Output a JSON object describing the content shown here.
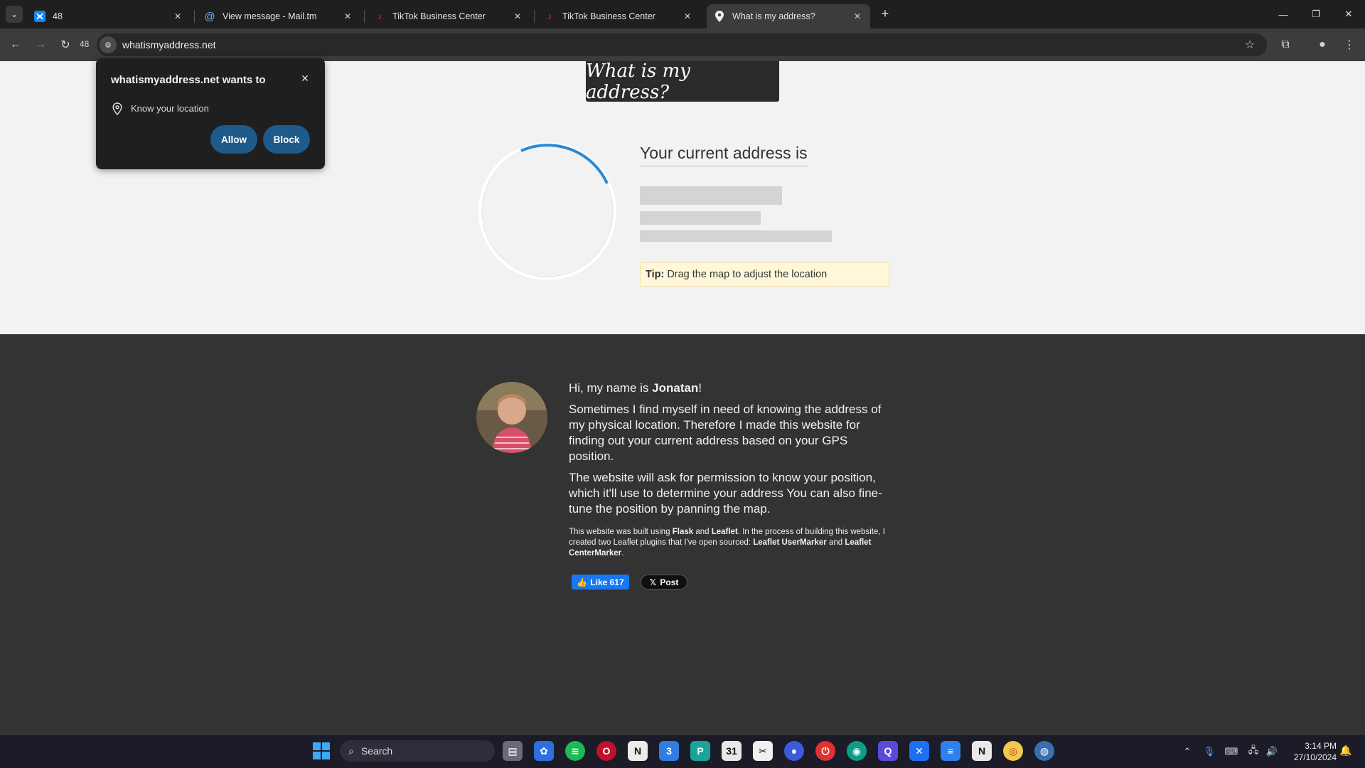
{
  "browser": {
    "tabs": [
      {
        "title": "48",
        "favicon": "bluesky-icon",
        "active": false
      },
      {
        "title": "View message - Mail.tm",
        "favicon": "at-sign-icon",
        "active": false
      },
      {
        "title": "TikTok Business Center",
        "favicon": "tiktok-icon",
        "active": false
      },
      {
        "title": "TikTok Business Center",
        "favicon": "tiktok-icon",
        "active": false
      },
      {
        "title": "What is my address?",
        "favicon": "location-pin-icon",
        "active": true
      }
    ],
    "reload_count": "48",
    "url": "whatismyaddress.net"
  },
  "permission_prompt": {
    "title": "whatismyaddress.net wants to",
    "request": "Know your location",
    "allow_label": "Allow",
    "block_label": "Block"
  },
  "page": {
    "header_title": "What is my address?",
    "address_heading": "Your current address is",
    "tip_label": "Tip:",
    "tip_text": "Drag the map to adjust the location",
    "bio": {
      "greeting_prefix": "Hi, my name is ",
      "name": "Jonatan",
      "greeting_suffix": "!",
      "para1": "Sometimes I find myself in need of knowing the address of my physical location. Therefore I made this website for finding out your current address based on your GPS position.",
      "para2": "The website will ask for permission to know your position, which it'll use to determine your address You can also fine-tune the position by panning the map.",
      "credits_1": "This website was built using ",
      "flask": "Flask",
      "and_1": " and ",
      "leaflet": "Leaflet",
      "credits_2": ". In the process of building this website, I created two Leaflet plugins that I've open sourced: ",
      "plugin_1": "Leaflet UserMarker",
      "and_2": " and ",
      "plugin_2": "Leaflet CenterMarker",
      "credits_end": "."
    },
    "fb_like": "Like 617",
    "x_post": "Post"
  },
  "taskbar": {
    "search_placeholder": "Search",
    "time": "3:14 PM",
    "date": "27/10/2024"
  },
  "colors": {
    "accent_blue": "#1e5a8a",
    "spinner_blue": "#2a8ad4",
    "footer_bg": "#333333",
    "tip_bg": "#fff7d9"
  }
}
